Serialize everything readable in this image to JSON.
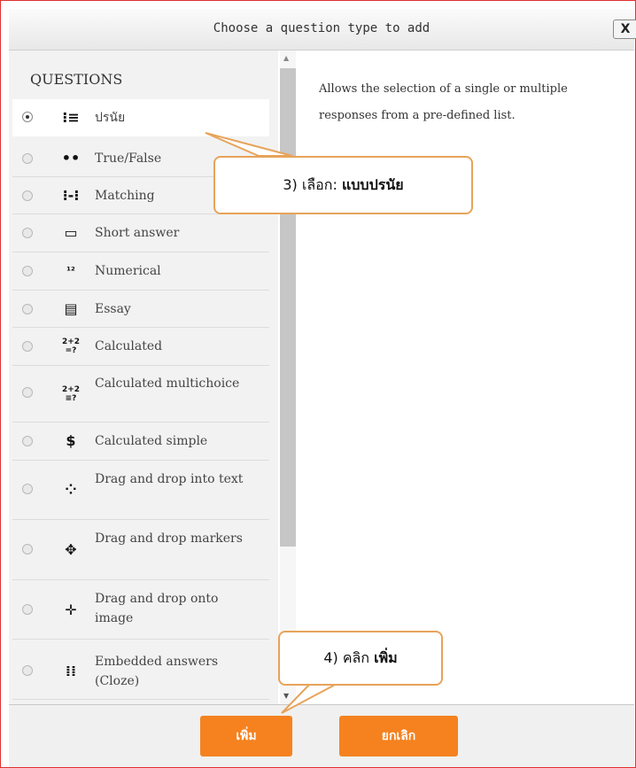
{
  "dialog": {
    "title": "Choose a question type to add",
    "close_label": "X"
  },
  "questions": {
    "heading": "QUESTIONS",
    "items": [
      {
        "label": "ปรนัย",
        "icon": "multichoice-icon",
        "selected": true
      },
      {
        "label": "True/False",
        "icon": "truefalse-icon",
        "selected": false
      },
      {
        "label": "Matching",
        "icon": "matching-icon",
        "selected": false
      },
      {
        "label": "Short answer",
        "icon": "shortanswer-icon",
        "selected": false
      },
      {
        "label": "Numerical",
        "icon": "numerical-icon",
        "selected": false
      },
      {
        "label": "Essay",
        "icon": "essay-icon",
        "selected": false
      },
      {
        "label": "Calculated",
        "icon": "calculated-icon",
        "selected": false
      },
      {
        "label": "Calculated multichoice",
        "icon": "calculated-multichoice-icon",
        "selected": false
      },
      {
        "label": "Calculated simple",
        "icon": "calculated-simple-icon",
        "selected": false
      },
      {
        "label": "Drag and drop into text",
        "icon": "ddwtos-icon",
        "selected": false
      },
      {
        "label": "Drag and drop markers",
        "icon": "ddmarker-icon",
        "selected": false
      },
      {
        "label": "Drag and drop onto image",
        "icon": "ddimageortext-icon",
        "selected": false
      },
      {
        "label": "Embedded answers (Cloze)",
        "icon": "cloze-icon",
        "selected": false
      }
    ]
  },
  "description": "Allows the selection of a single or multiple responses from a pre-defined list.",
  "buttons": {
    "add_label": "เพิ่ม",
    "cancel_label": "ยกเลิก"
  },
  "callouts": {
    "step3_prefix": "3)  เลือก: ",
    "step3_bold": "แบบปรนัย",
    "step4_prefix": "4)  คลิก ",
    "step4_bold": "เพิ่ม"
  },
  "colors": {
    "accent": "#f5821f",
    "callout_border": "#e7a35a",
    "frame_border": "#e03030"
  }
}
